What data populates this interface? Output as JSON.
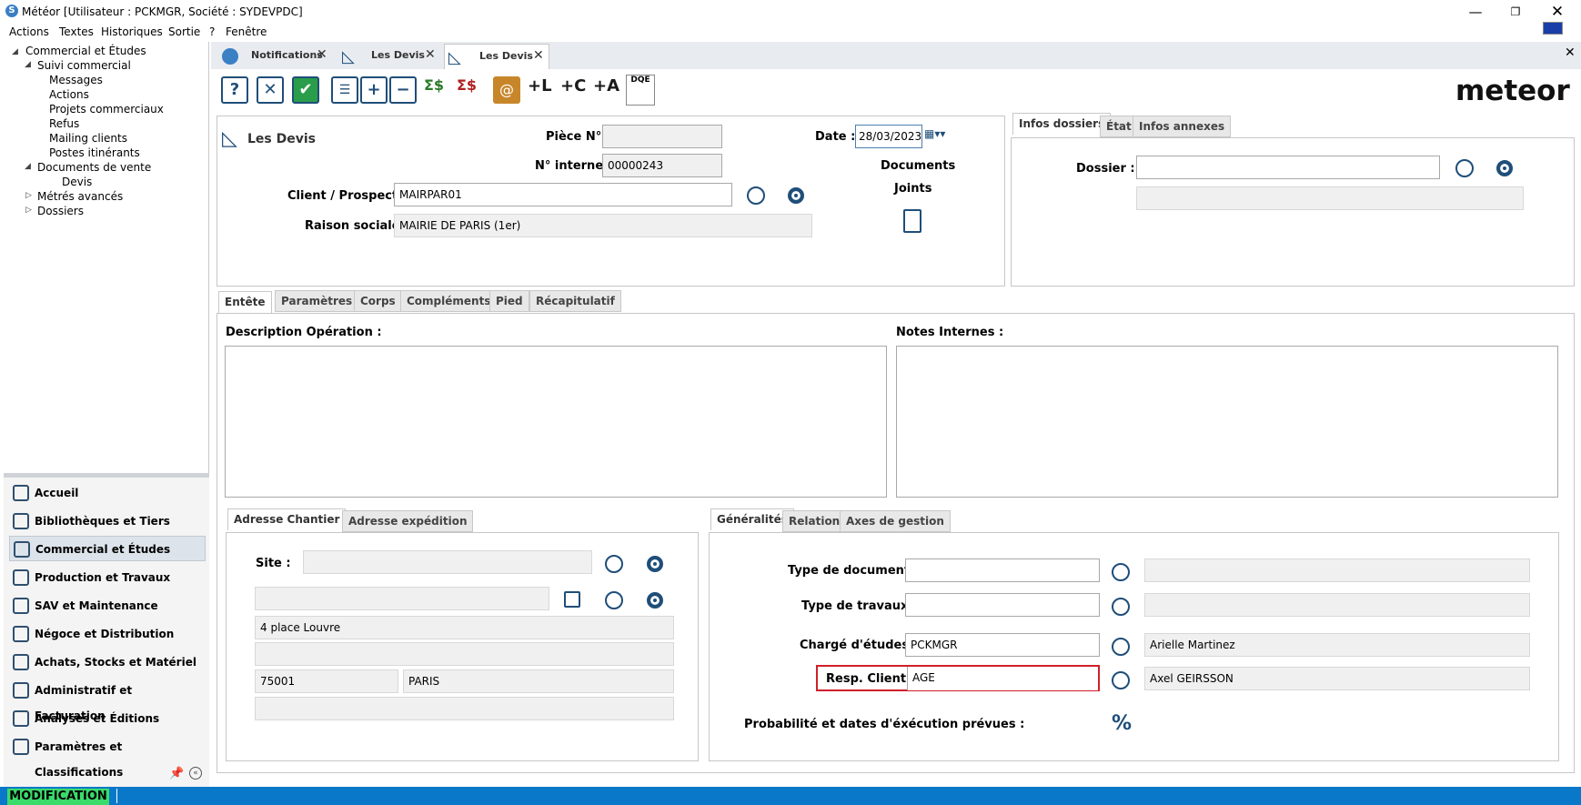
{
  "window": {
    "title": "Météor [Utilisateur : PCKMGR, Société : SYDEVPDC]"
  },
  "menu": [
    "Actions",
    "Textes",
    "Historiques",
    "Sortie",
    "?",
    "Fenêtre"
  ],
  "tree": [
    {
      "label": "Commercial et Études",
      "level": 0,
      "expanded": true
    },
    {
      "label": "Suivi commercial",
      "level": 1,
      "expanded": true
    },
    {
      "label": "Messages",
      "level": 2
    },
    {
      "label": "Actions",
      "level": 2
    },
    {
      "label": "Projets commerciaux",
      "level": 2
    },
    {
      "label": "Refus",
      "level": 2
    },
    {
      "label": "Mailing clients",
      "level": 2
    },
    {
      "label": "Postes itinérants",
      "level": 2
    },
    {
      "label": "Documents de vente",
      "level": 1,
      "expanded": true
    },
    {
      "label": "Devis",
      "level": 2
    },
    {
      "label": "Métrés avancés",
      "level": 1,
      "expanded": false
    },
    {
      "label": "Dossiers",
      "level": 1,
      "expanded": false
    }
  ],
  "nav": [
    {
      "label": "Accueil"
    },
    {
      "label": "Bibliothèques et Tiers"
    },
    {
      "label": "Commercial et Études",
      "selected": true
    },
    {
      "label": "Production et Travaux"
    },
    {
      "label": "SAV et Maintenance"
    },
    {
      "label": "Négoce et Distribution"
    },
    {
      "label": "Achats, Stocks et Matériel"
    },
    {
      "label": "Administratif et Facturation"
    },
    {
      "label": "Analyses et Éditions"
    },
    {
      "label": "Paramètres et Classifications"
    }
  ],
  "doc_tabs": [
    {
      "label": "Notifications"
    },
    {
      "label": "Les Devis"
    },
    {
      "label": "Les Devis",
      "active": true
    }
  ],
  "brand": "meteor",
  "header": {
    "title": "Les Devis",
    "piece_label": "Pièce N° :",
    "piece_value": "",
    "interne_label": "N° interne :",
    "interne_value": "00000243",
    "client_label": "Client / Prospect :",
    "client_value": "MAIRPAR01",
    "raison_label": "Raison sociale :",
    "raison_value": "MAIRIE DE PARIS (1er)",
    "date_label": "Date :",
    "date_value": "28/03/2023",
    "docs_label": "Documents",
    "joints_label": "Joints"
  },
  "dossier_tabs": [
    "Infos dossiers",
    "État",
    "Infos annexes"
  ],
  "dossier": {
    "label": "Dossier :",
    "value": ""
  },
  "main_tabs": [
    "Entête",
    "Paramètres",
    "Corps",
    "Compléments",
    "Pied",
    "Récapitulatif"
  ],
  "entete": {
    "desc_label": "Description Opération :",
    "notes_label": "Notes Internes :"
  },
  "addr_tabs": [
    "Adresse Chantier",
    "Adresse expédition"
  ],
  "address": {
    "site_label": "Site :",
    "line1": "",
    "line2": "4 place Louvre",
    "line3": "",
    "zip": "75001",
    "city": "PARIS",
    "line5": ""
  },
  "gen_tabs": [
    "Généralités",
    "Relations",
    "Axes de gestion"
  ],
  "general": {
    "type_doc_label": "Type de document :",
    "type_doc_value": "",
    "type_trav_label": "Type de travaux :",
    "type_trav_value": "",
    "charge_label": "Chargé d'études :",
    "charge_value": "PCKMGR",
    "charge_name": "Arielle Martinez",
    "resp_label": "Resp. Client :",
    "resp_value": "AGE",
    "resp_name": "Axel GEIRSSON",
    "proba_label": "Probabilité et dates d'éxécution prévues :"
  },
  "status": {
    "mode": "MODIFICATION"
  },
  "colors": {
    "accent": "#1f4e79",
    "status_bar": "#0a78c8",
    "mode_bg": "#3adb6a",
    "highlight": "#d0202a"
  }
}
